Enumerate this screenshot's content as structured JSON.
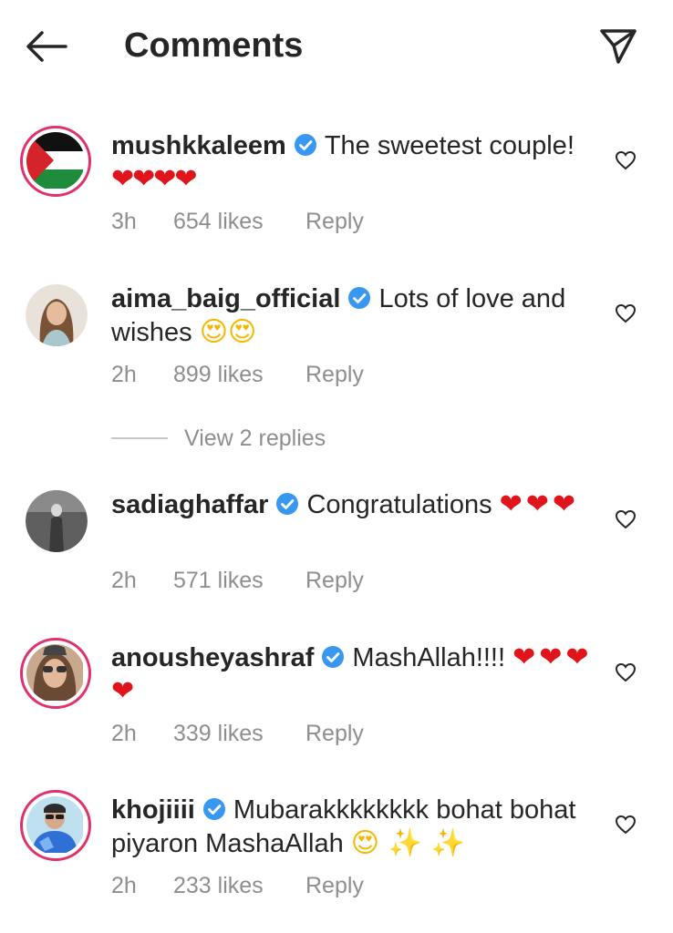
{
  "header": {
    "title": "Comments"
  },
  "comments": [
    {
      "username": "mushkkaleem",
      "text": "The sweetest couple!",
      "emoji": "❤❤❤❤",
      "emoji_type": "heart",
      "time": "3h",
      "likes": "654 likes",
      "reply": "Reply",
      "avatar": "palestine-flag-avatar"
    },
    {
      "username": "aima_baig_official",
      "text": "Lots of love and wishes",
      "emoji": "😍😍",
      "emoji_type": "face",
      "time": "2h",
      "likes": "899 likes",
      "reply": "Reply",
      "avatar": "woman-avatar"
    },
    {
      "username": "sadiaghaffar",
      "text": "Congratulations",
      "emoji": "❤❤❤",
      "emoji_type": "heart",
      "time": "2h",
      "likes": "571 likes",
      "reply": "Reply",
      "avatar": "grayscale-avatar"
    },
    {
      "username": "anousheyashraf",
      "text": "MashAllah!!!!",
      "emoji": "❤❤❤❤",
      "emoji_type": "heart",
      "time": "2h",
      "likes": "339 likes",
      "reply": "Reply",
      "avatar": "sunglasses-woman-avatar"
    },
    {
      "username": "khojiiii",
      "text": "Mubarakkkkkkkk bohat bohat piyaron MashaAllah",
      "emoji": "😍 ✨ ✨",
      "emoji_type": "face",
      "time": "2h",
      "likes": "233 likes",
      "reply": "Reply",
      "avatar": "blue-outfit-avatar"
    }
  ],
  "view_replies": "View 2 replies",
  "colors": {
    "text": "#262626",
    "meta": "#8e8e8e",
    "verified": "#3897f0",
    "story_ring": "#e1306c",
    "heart": "#e0151b"
  },
  "icons": {
    "back": "arrow-left-icon",
    "share": "paper-plane-icon",
    "like": "heart-outline-icon",
    "verified": "verified-badge-icon"
  }
}
